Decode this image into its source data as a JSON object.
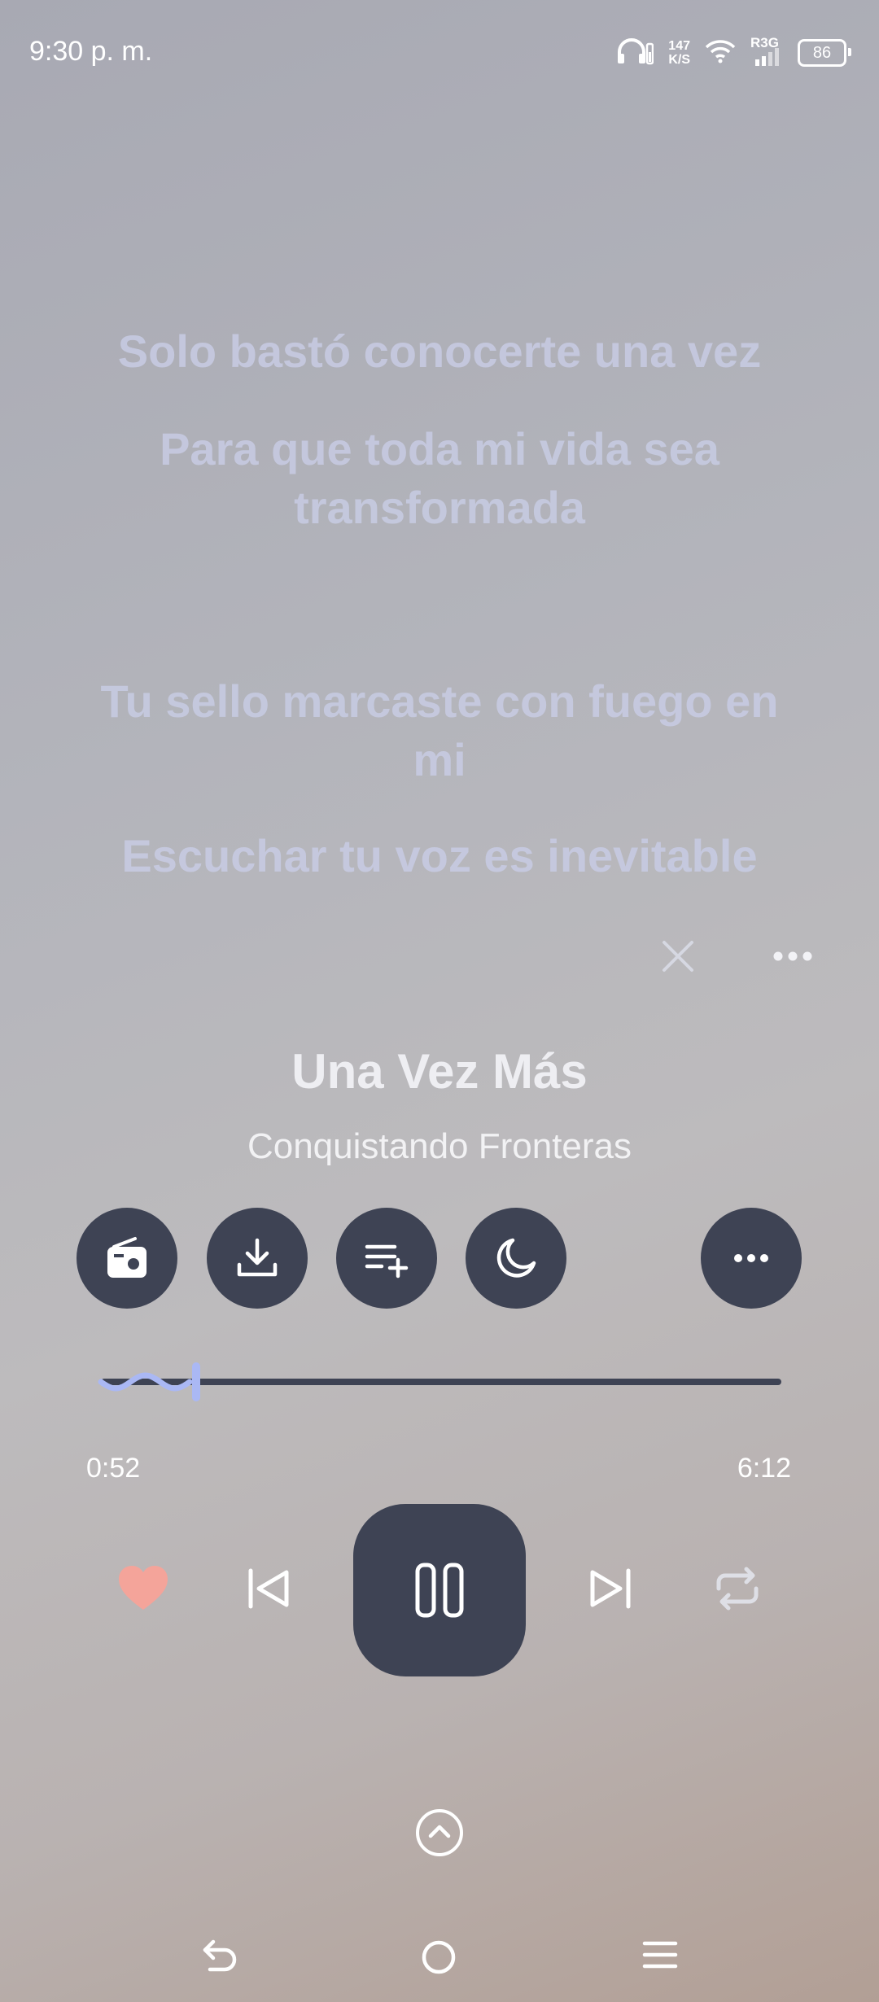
{
  "status_bar": {
    "time": "9:30 p. m.",
    "net_speed_value": "147",
    "net_speed_unit": "K/S",
    "network_label": "R3G",
    "battery": "86",
    "icons": [
      "headphones-icon",
      "wifi-icon",
      "signal-icon",
      "battery-icon"
    ]
  },
  "lyrics": {
    "line1": "Solo bastó conocerte una vez",
    "line2": "Para que toda mi vida sea transformada",
    "line3": "Tu sello marcaste con fuego en mi",
    "line4": "Escuchar tu voz es inevitable"
  },
  "song": {
    "title": "Una Vez Más",
    "artist": "Conquistando Fronteras"
  },
  "actions": [
    "radio-icon",
    "download-icon",
    "add-to-playlist-icon",
    "sleep-timer-icon",
    "more-icon"
  ],
  "progress": {
    "current": "0:52",
    "total": "6:12",
    "fraction": 0.14
  },
  "playback": {
    "state": "playing",
    "liked": true,
    "repeat": "off"
  },
  "colors": {
    "button_bg": "#3e4354",
    "like": "#f4a49a",
    "progress_accent": "#aab8f4",
    "lyrics": "#c8cce4"
  },
  "nav_bar": [
    "back-icon",
    "home-icon",
    "menu-icon"
  ]
}
